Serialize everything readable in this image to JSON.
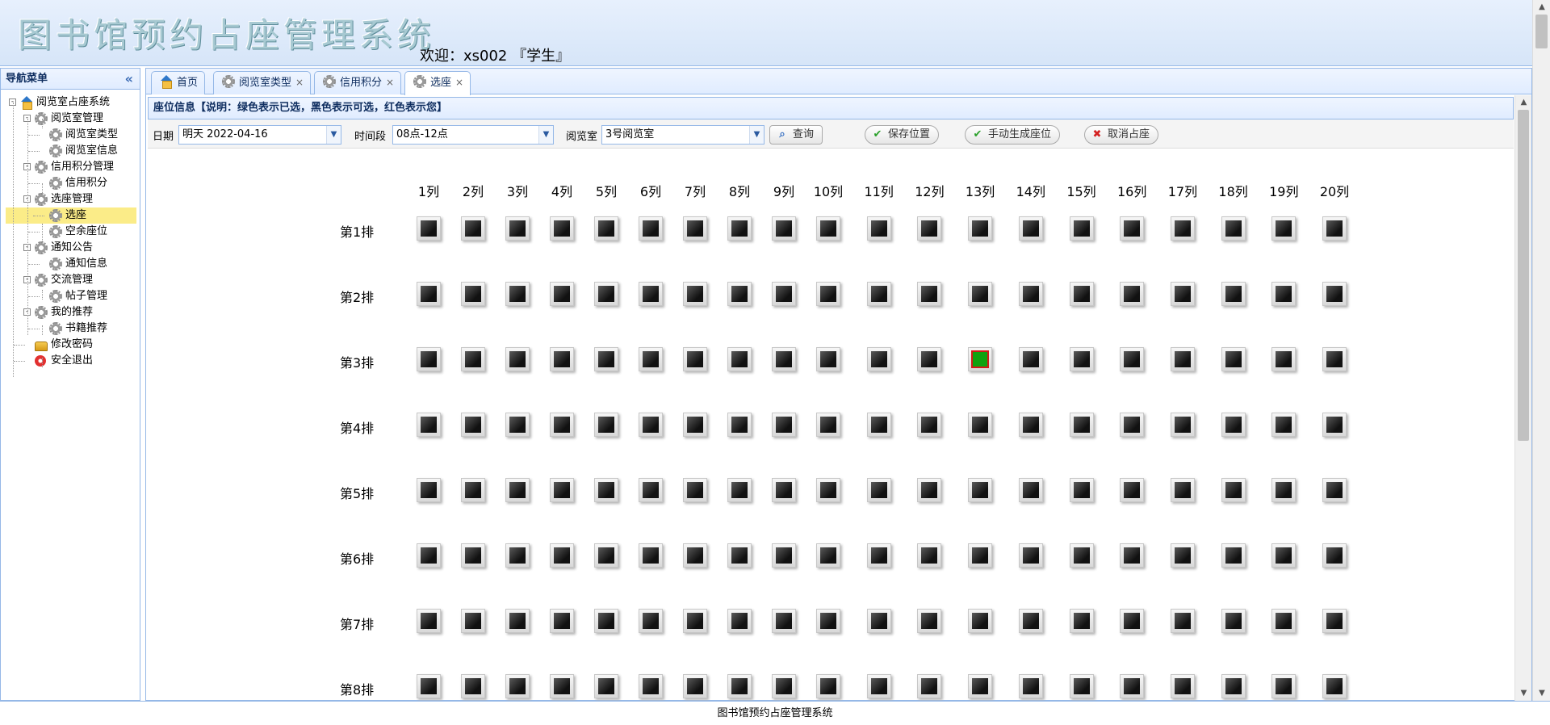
{
  "header": {
    "app_title": "图书馆预约占座管理系统",
    "welcome": "欢迎：xs002 『学生』"
  },
  "nav": {
    "title": "导航菜单",
    "collapse_icon": "double-chevron-left-icon",
    "tree": [
      {
        "label": "阅览室占座系统",
        "level": 0,
        "icon": "home-icon",
        "toggle": "-"
      },
      {
        "label": "阅览室管理",
        "level": 1,
        "icon": "gear-icon",
        "toggle": "-"
      },
      {
        "label": "阅览室类型",
        "level": 2,
        "icon": "gear-icon"
      },
      {
        "label": "阅览室信息",
        "level": 2,
        "icon": "gear-icon"
      },
      {
        "label": "信用积分管理",
        "level": 1,
        "icon": "gear-icon",
        "toggle": "-"
      },
      {
        "label": "信用积分",
        "level": 2,
        "icon": "gear-icon"
      },
      {
        "label": "选座管理",
        "level": 1,
        "icon": "gear-icon",
        "toggle": "-"
      },
      {
        "label": "选座",
        "level": 2,
        "icon": "gear-icon",
        "selected": true
      },
      {
        "label": "空余座位",
        "level": 2,
        "icon": "gear-icon"
      },
      {
        "label": "通知公告",
        "level": 1,
        "icon": "gear-icon",
        "toggle": "-"
      },
      {
        "label": "通知信息",
        "level": 2,
        "icon": "gear-icon"
      },
      {
        "label": "交流管理",
        "level": 1,
        "icon": "gear-icon",
        "toggle": "-"
      },
      {
        "label": "帖子管理",
        "level": 2,
        "icon": "gear-icon"
      },
      {
        "label": "我的推荐",
        "level": 1,
        "icon": "gear-icon",
        "toggle": "-"
      },
      {
        "label": "书籍推荐",
        "level": 2,
        "icon": "gear-icon"
      },
      {
        "label": "修改密码",
        "level": 1,
        "icon": "lock-icon"
      },
      {
        "label": "安全退出",
        "level": 1,
        "icon": "exit-icon"
      }
    ]
  },
  "tabs": [
    {
      "label": "首页",
      "icon": "home-icon",
      "closable": false,
      "active": false
    },
    {
      "label": "阅览室类型",
      "icon": "gear-icon",
      "closable": true,
      "active": false
    },
    {
      "label": "信用积分",
      "icon": "gear-icon",
      "closable": true,
      "active": false
    },
    {
      "label": "选座",
      "icon": "gear-icon",
      "closable": true,
      "active": true
    }
  ],
  "panel": {
    "title": "座位信息【说明：绿色表示已选，黑色表示可选，红色表示您】"
  },
  "toolbar": {
    "date_label": "日期",
    "date_value": "明天  2022-04-16",
    "time_label": "时间段",
    "time_value": "08点-12点",
    "room_label": "阅览室",
    "room_value": "3号阅览室",
    "search_label": "查询",
    "save_label": "保存位置",
    "generate_label": "手动生成座位",
    "cancel_label": "取消占座"
  },
  "seats": {
    "columns": [
      "1列",
      "2列",
      "3列",
      "4列",
      "5列",
      "6列",
      "7列",
      "8列",
      "9列",
      "10列",
      "11列",
      "12列",
      "13列",
      "14列",
      "15列",
      "16列",
      "17列",
      "18列",
      "19列",
      "20列"
    ],
    "rows": [
      "第1排",
      "第2排",
      "第3排",
      "第4排",
      "第5排",
      "第6排",
      "第7排",
      "第8排"
    ],
    "taken": [
      {
        "row": 3,
        "col": 13
      }
    ],
    "colors": {
      "available": "#1a1a1a",
      "taken": "#0fa20f",
      "mine": "#d21a1a"
    }
  },
  "footer": {
    "text": "图书馆预约占座管理系统"
  }
}
